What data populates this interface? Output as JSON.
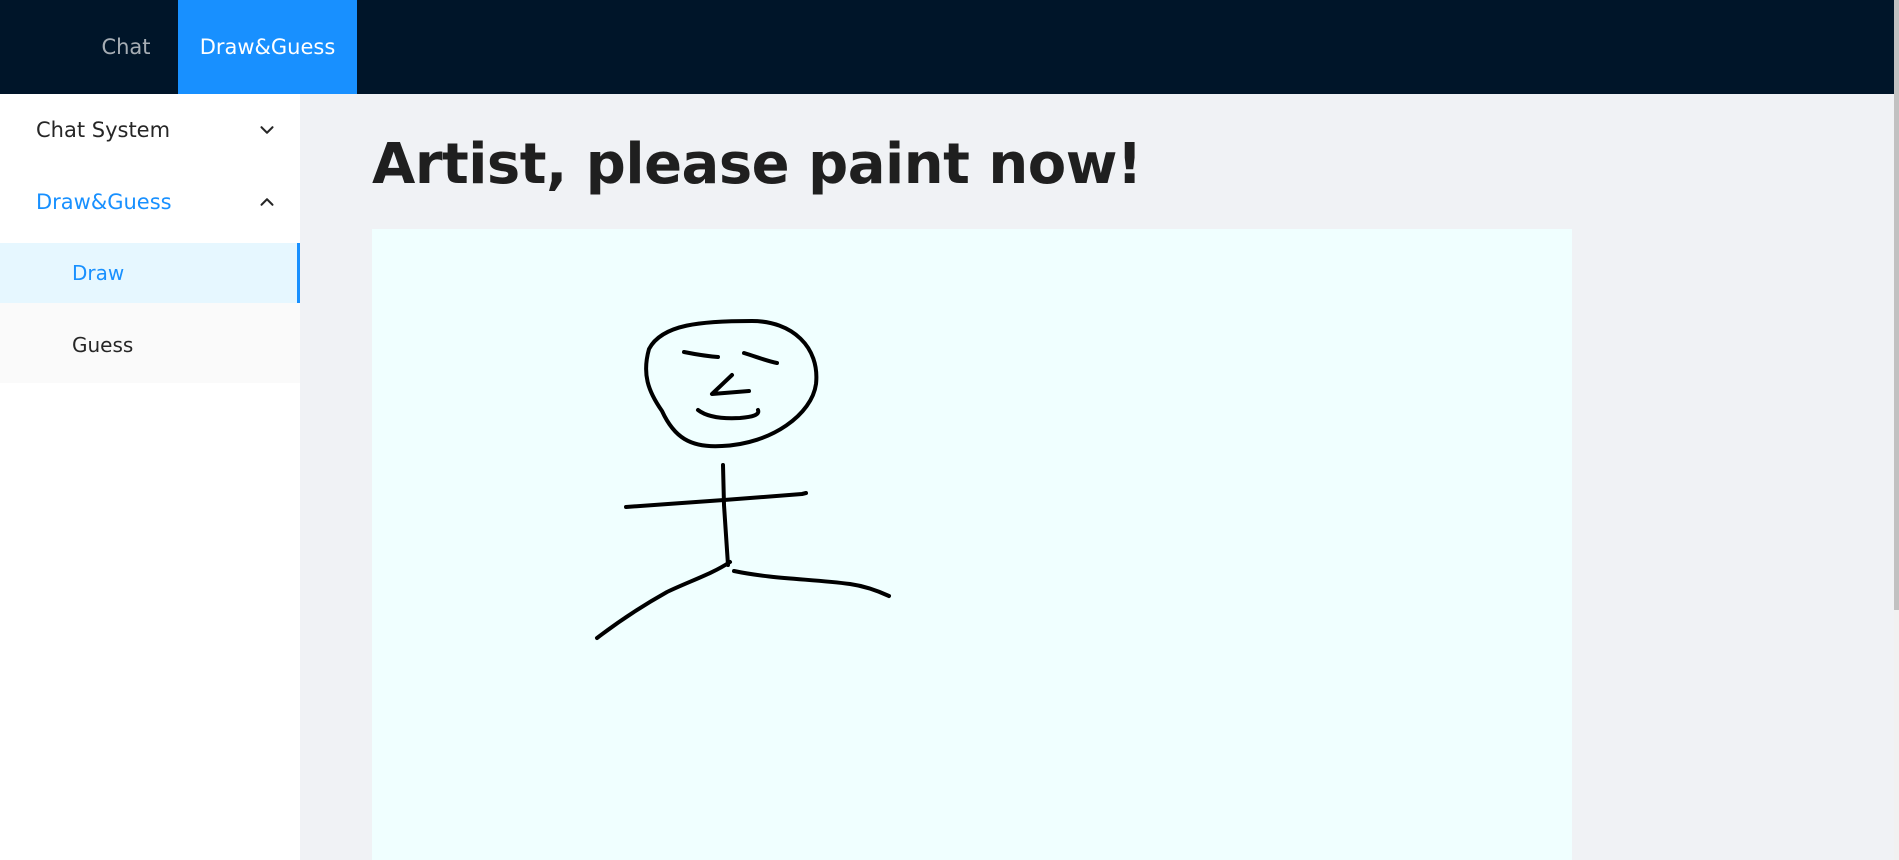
{
  "header": {
    "tabs": [
      {
        "label": "Chat",
        "active": false
      },
      {
        "label": "Draw&Guess",
        "active": true
      }
    ]
  },
  "sidebar": {
    "groups": [
      {
        "label": "Chat System",
        "expanded": false,
        "icon": "chevron-down-icon"
      },
      {
        "label": "Draw&Guess",
        "expanded": true,
        "icon": "chevron-up-icon",
        "items": [
          {
            "label": "Draw",
            "selected": true
          },
          {
            "label": "Guess",
            "selected": false
          }
        ]
      }
    ]
  },
  "main": {
    "title": "Artist, please paint now!",
    "canvas": {
      "background": "#f0ffff",
      "drawing": "stick-figure"
    }
  },
  "colors": {
    "header_bg": "#001529",
    "accent": "#1890ff",
    "content_bg": "#f0f2f5",
    "canvas_bg": "#f0ffff"
  }
}
